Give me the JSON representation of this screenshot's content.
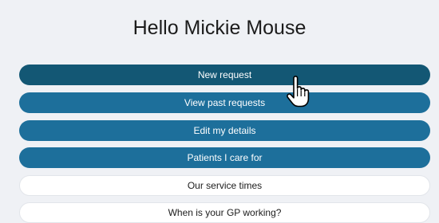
{
  "greeting": "Hello Mickie Mouse",
  "menu": {
    "items": [
      {
        "label": "New request",
        "style": "primary",
        "state": "hover"
      },
      {
        "label": "View past requests",
        "style": "primary"
      },
      {
        "label": "Edit my details",
        "style": "primary"
      },
      {
        "label": "Patients I care for",
        "style": "primary"
      },
      {
        "label": "Our service times",
        "style": "secondary"
      },
      {
        "label": "When is your GP working?",
        "style": "secondary"
      }
    ]
  },
  "colors": {
    "background": "#eff1f5",
    "primary_button": "#1d6f9b",
    "primary_button_hover": "#135774",
    "secondary_button": "#ffffff"
  },
  "cursor_icon": "hand-pointer-icon"
}
